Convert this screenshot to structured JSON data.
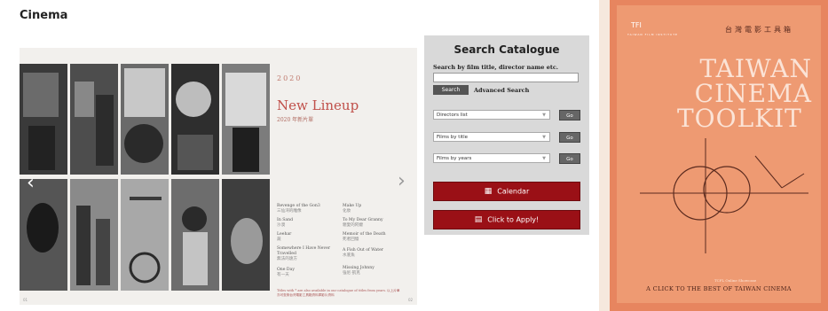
{
  "page": {
    "title": "Cinema"
  },
  "slideshow": {
    "year": "2020",
    "heading": "New Lineup",
    "subheading": "2020 年新片單",
    "films": [
      {
        "en": "Revenge of the Gon3",
        "cn": "三仙湾的雕像"
      },
      {
        "en": "Make Up",
        "cn": "化妝"
      },
      {
        "en": "In Sand",
        "cn": "沙漠"
      },
      {
        "en": "To My Dear Granny",
        "cn": "親愛的阿嬤"
      },
      {
        "en": "Leehar",
        "cn": "蔬"
      },
      {
        "en": "Memoir of the Death",
        "cn": "死者回憶"
      },
      {
        "en": "Somewhere I Have Never Travelled",
        "cn": "無法的遠方"
      },
      {
        "en": "A Fish Out of Water",
        "cn": "水底魚"
      },
      {
        "en": "One Day",
        "cn": "有一天"
      },
      {
        "en": "Missing Johnny",
        "cn": "強尼·凱克"
      }
    ],
    "footnote": "Titles with * are also available in our catalogue of titles from years. 以上片單亦可查詢台灣電影工具箱資料庫影片資料",
    "prev_arrow": "‹",
    "next_arrow": "›",
    "page_left": "01",
    "page_right": "02"
  },
  "search": {
    "title": "Search Catalogue",
    "label": "Search by film title, director name etc.",
    "input_value": "",
    "search_button": "Search",
    "advanced_link": "Advanced Search",
    "dropdowns": [
      {
        "selected": "Directors list",
        "go": "Go"
      },
      {
        "selected": "Films by title",
        "go": "Go"
      },
      {
        "selected": "Films by years",
        "go": "Go"
      }
    ],
    "calendar_button": "Calendar",
    "apply_button": "Click to Apply!"
  },
  "toolkit": {
    "logo": "TFI",
    "logo_sub": "TAIWAN FILM INSTITUTE",
    "top_text": "台灣電影工具箱",
    "title_line1": "TAIWAN",
    "title_line2": "CINEMA",
    "title_line3": "TOOLKIT",
    "small_text": "TCFL Online Showcase",
    "bottom_text": "A CLICK TO THE BEST OF TAIWAN CINEMA"
  }
}
